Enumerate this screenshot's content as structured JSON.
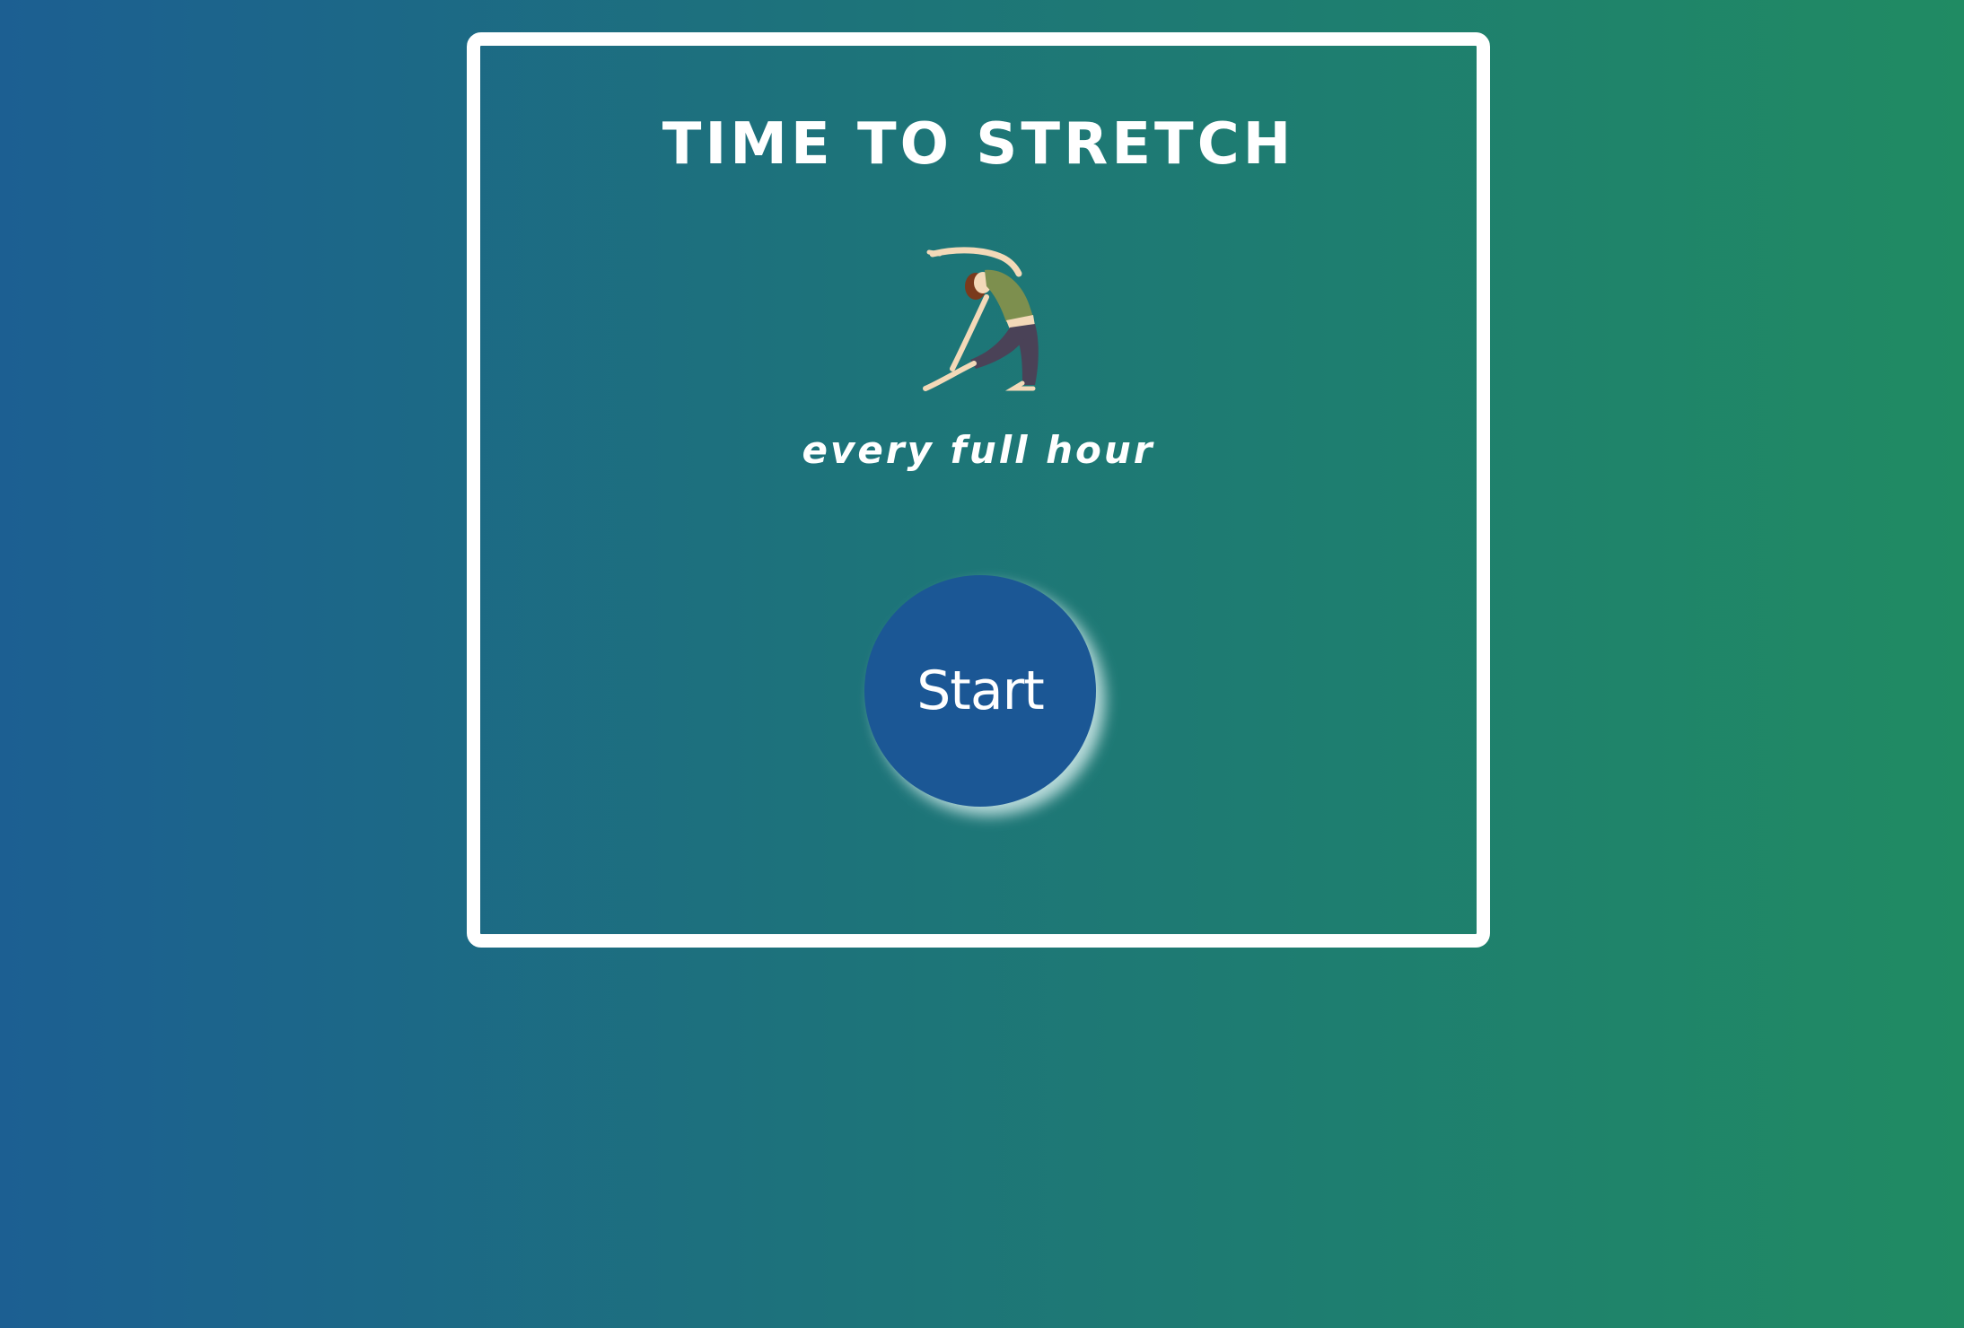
{
  "card": {
    "title": "TIME TO STRETCH",
    "illustration": "woman-stretching-icon",
    "subtitle": "every full hour"
  },
  "controls": {
    "start_label": "Start"
  },
  "colors": {
    "background_start": "#1c5f92",
    "background_end": "#208b63",
    "button": "#1b5795",
    "border": "#ffffff"
  }
}
